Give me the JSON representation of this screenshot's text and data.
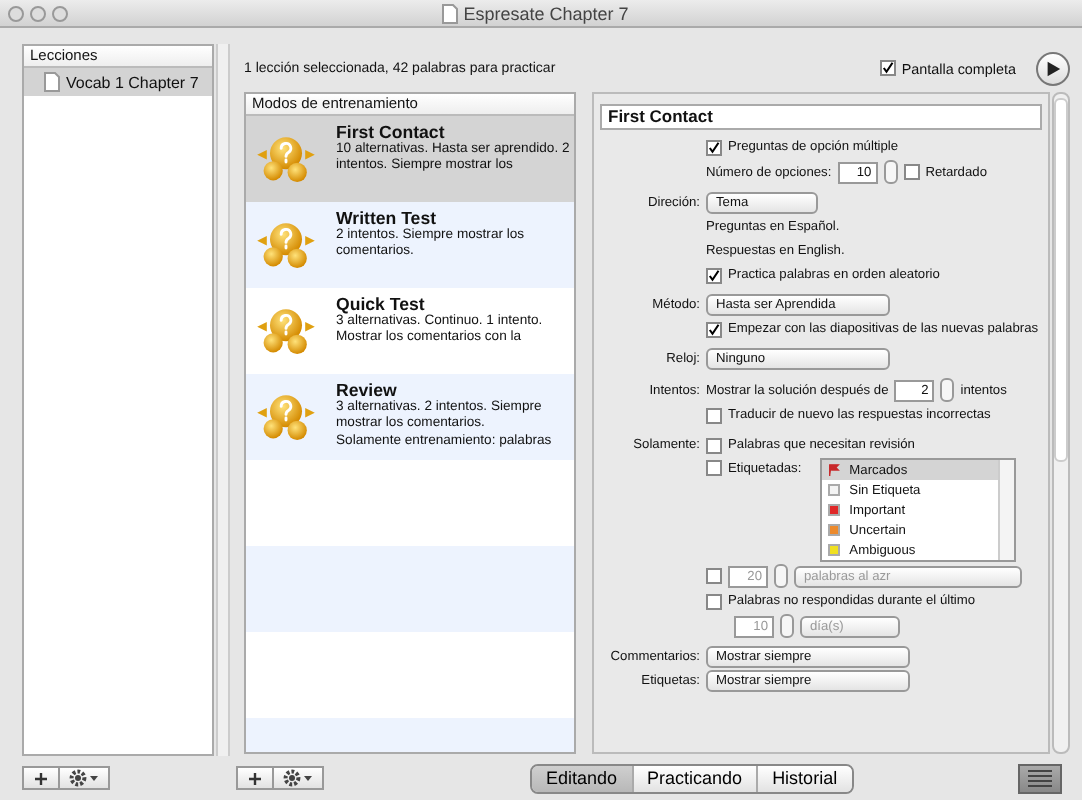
{
  "window": {
    "title": "Espresate Chapter 7"
  },
  "lessons": {
    "header": "Lecciones",
    "items": [
      {
        "label": "Vocab 1 Chapter 7",
        "selected": true
      }
    ]
  },
  "summary": "1 lección seleccionada, 42 palabras para practicar",
  "fullscreen": {
    "label": "Pantalla completa",
    "checked": true
  },
  "modes": {
    "header": "Modos de entrenamiento",
    "items": [
      {
        "title": "First Contact",
        "description": "10 alternativas. Hasta ser aprendido. 2 intentos. Siempre mostrar los",
        "selected": true
      },
      {
        "title": "Written Test",
        "description": "2 intentos. Siempre mostrar los comentarios.",
        "selected": false
      },
      {
        "title": "Quick Test",
        "description": "3 alternativas. Continuo. 1 intento. Mostrar los comentarios con la",
        "selected": false
      },
      {
        "title": "Review",
        "description": "3 alternativas. 2 intentos. Siempre mostrar los comentarios.",
        "note": "Solamente entrenamiento: palabras",
        "selected": false
      }
    ]
  },
  "settings": {
    "name": "First Contact",
    "multiple_choice": {
      "label": "Preguntas de opción múltiple",
      "checked": true
    },
    "options": {
      "label": "Número de opciones:",
      "value": "10"
    },
    "delayed": {
      "label": "Retardado",
      "checked": false
    },
    "direction": {
      "label": "Direción:",
      "value": "Tema"
    },
    "direction_note": [
      "Preguntas en Español.",
      "Respuestas en English."
    ],
    "random_order": {
      "label": "Practica palabras en orden aleatorio",
      "checked": true
    },
    "method": {
      "label": "Método:",
      "value": "Hasta ser Aprendida"
    },
    "start_slides": {
      "label": "Empezar con las diapositivas de las nuevas palabras",
      "checked": true
    },
    "clock": {
      "label": "Reloj:",
      "value": "Ninguno"
    },
    "attempts": {
      "label": "Intentos:",
      "text": "Mostrar la solución después de",
      "value": "2",
      "suffix": "intentos"
    },
    "retranslate": {
      "label": "Traducir de nuevo las respuestas incorrectas",
      "checked": false
    },
    "only": {
      "label": "Solamente:",
      "review": {
        "label": "Palabras que necesitan revisión",
        "checked": false
      },
      "tagged": {
        "label": "Etiquetadas:",
        "checked": false
      },
      "tags": [
        {
          "label": "Marcados",
          "kind": "flag",
          "color": "#c8282a",
          "selected": true
        },
        {
          "label": "Sin Etiqueta",
          "kind": "swatch",
          "color": "#f4f4f4",
          "selected": false
        },
        {
          "label": "Important",
          "kind": "swatch",
          "color": "#e02828",
          "selected": false
        },
        {
          "label": "Uncertain",
          "kind": "swatch",
          "color": "#ec8a2c",
          "selected": false
        },
        {
          "label": "Ambiguous",
          "kind": "swatch",
          "color": "#f0e020",
          "selected": false
        }
      ],
      "random_words": {
        "checked": false,
        "value": "20",
        "select": "palabras al azr",
        "disabled": true
      },
      "unanswered": {
        "label": "Palabras no respondidas durante el último",
        "checked": false
      },
      "days": {
        "value": "10",
        "select": "día(s)",
        "disabled": true
      }
    },
    "comments": {
      "label": "Commentarios:",
      "value": "Mostrar siempre"
    },
    "labels": {
      "label": "Etiquetas:",
      "value": "Mostrar siempre"
    }
  },
  "view_tabs": [
    {
      "label": "Editando",
      "selected": true
    },
    {
      "label": "Practicando",
      "selected": false
    },
    {
      "label": "Historial",
      "selected": false
    }
  ]
}
